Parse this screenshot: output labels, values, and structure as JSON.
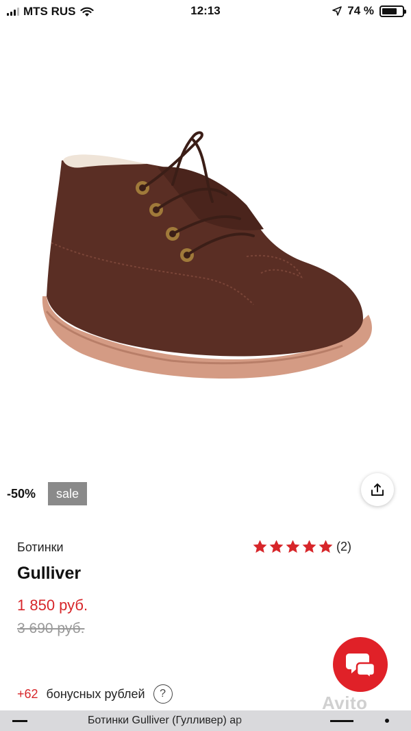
{
  "status_bar": {
    "carrier": "MTS RUS",
    "time": "12:13",
    "battery_percent": "74 %",
    "battery_level": 0.74
  },
  "product": {
    "discount": "-50%",
    "sale_label": "sale",
    "category": "Ботинки",
    "brand": "Gulliver",
    "price_current": "1 850 руб.",
    "price_old": "3 690 руб.",
    "rating_stars": 5,
    "rating_count": "(2)",
    "bonus_amount": "+62",
    "bonus_text": "бонусных рублей",
    "help_symbol": "?"
  },
  "watermark": "Avito",
  "bottom_bar": {
    "title": "Ботинки Gulliver (Гулливер) ар"
  },
  "colors": {
    "price_red": "#d7262a",
    "chat_red": "#e02128",
    "sale_badge_gray": "#8a8a8a",
    "shoe_brown": "#5a2e24"
  },
  "icons": {
    "share": "share-icon",
    "chat": "chat-bubble-icon",
    "star": "star-icon",
    "help": "help-icon",
    "signal": "signal-icon",
    "wifi": "wifi-icon",
    "location": "location-arrow-icon",
    "battery": "battery-icon"
  }
}
